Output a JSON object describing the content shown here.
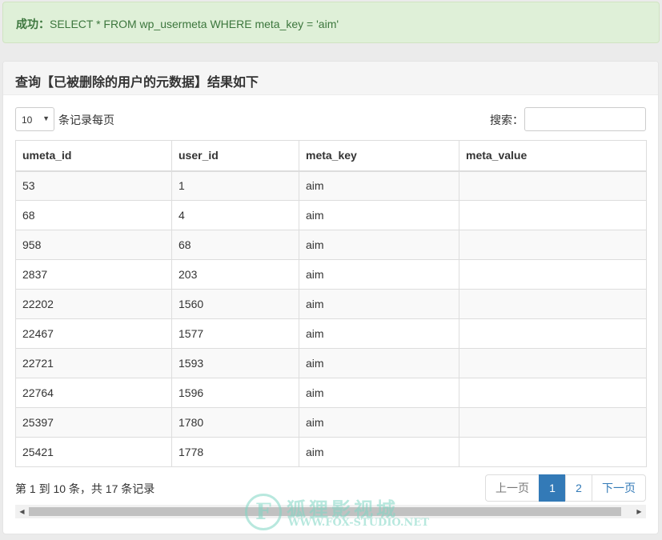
{
  "alert": {
    "label": "成功：",
    "message": "SELECT * FROM wp_usermeta WHERE meta_key = 'aim'"
  },
  "panel": {
    "title": "查询【已被删除的用户的元数据】结果如下"
  },
  "length_menu": {
    "selected": "10",
    "label": "条记录每页"
  },
  "search": {
    "label": "搜索：",
    "value": ""
  },
  "table": {
    "columns": [
      "umeta_id",
      "user_id",
      "meta_key",
      "meta_value"
    ],
    "rows": [
      [
        "53",
        "1",
        "aim",
        ""
      ],
      [
        "68",
        "4",
        "aim",
        ""
      ],
      [
        "958",
        "68",
        "aim",
        ""
      ],
      [
        "2837",
        "203",
        "aim",
        ""
      ],
      [
        "22202",
        "1560",
        "aim",
        ""
      ],
      [
        "22467",
        "1577",
        "aim",
        ""
      ],
      [
        "22721",
        "1593",
        "aim",
        ""
      ],
      [
        "22764",
        "1596",
        "aim",
        ""
      ],
      [
        "25397",
        "1780",
        "aim",
        ""
      ],
      [
        "25421",
        "1778",
        "aim",
        ""
      ]
    ]
  },
  "info": "第 1 到 10 条，共 17 条记录",
  "pagination": {
    "prev": "上一页",
    "pages": [
      "1",
      "2"
    ],
    "current": "1",
    "next": "下一页"
  },
  "watermark": {
    "logo_letter": "F",
    "title": "狐狸影视城",
    "url": "WWW.FOX-STUDIO.NET"
  },
  "colors": {
    "accent": "#337ab7",
    "alert_bg": "#dff0d8",
    "alert_text": "#3c763d"
  }
}
